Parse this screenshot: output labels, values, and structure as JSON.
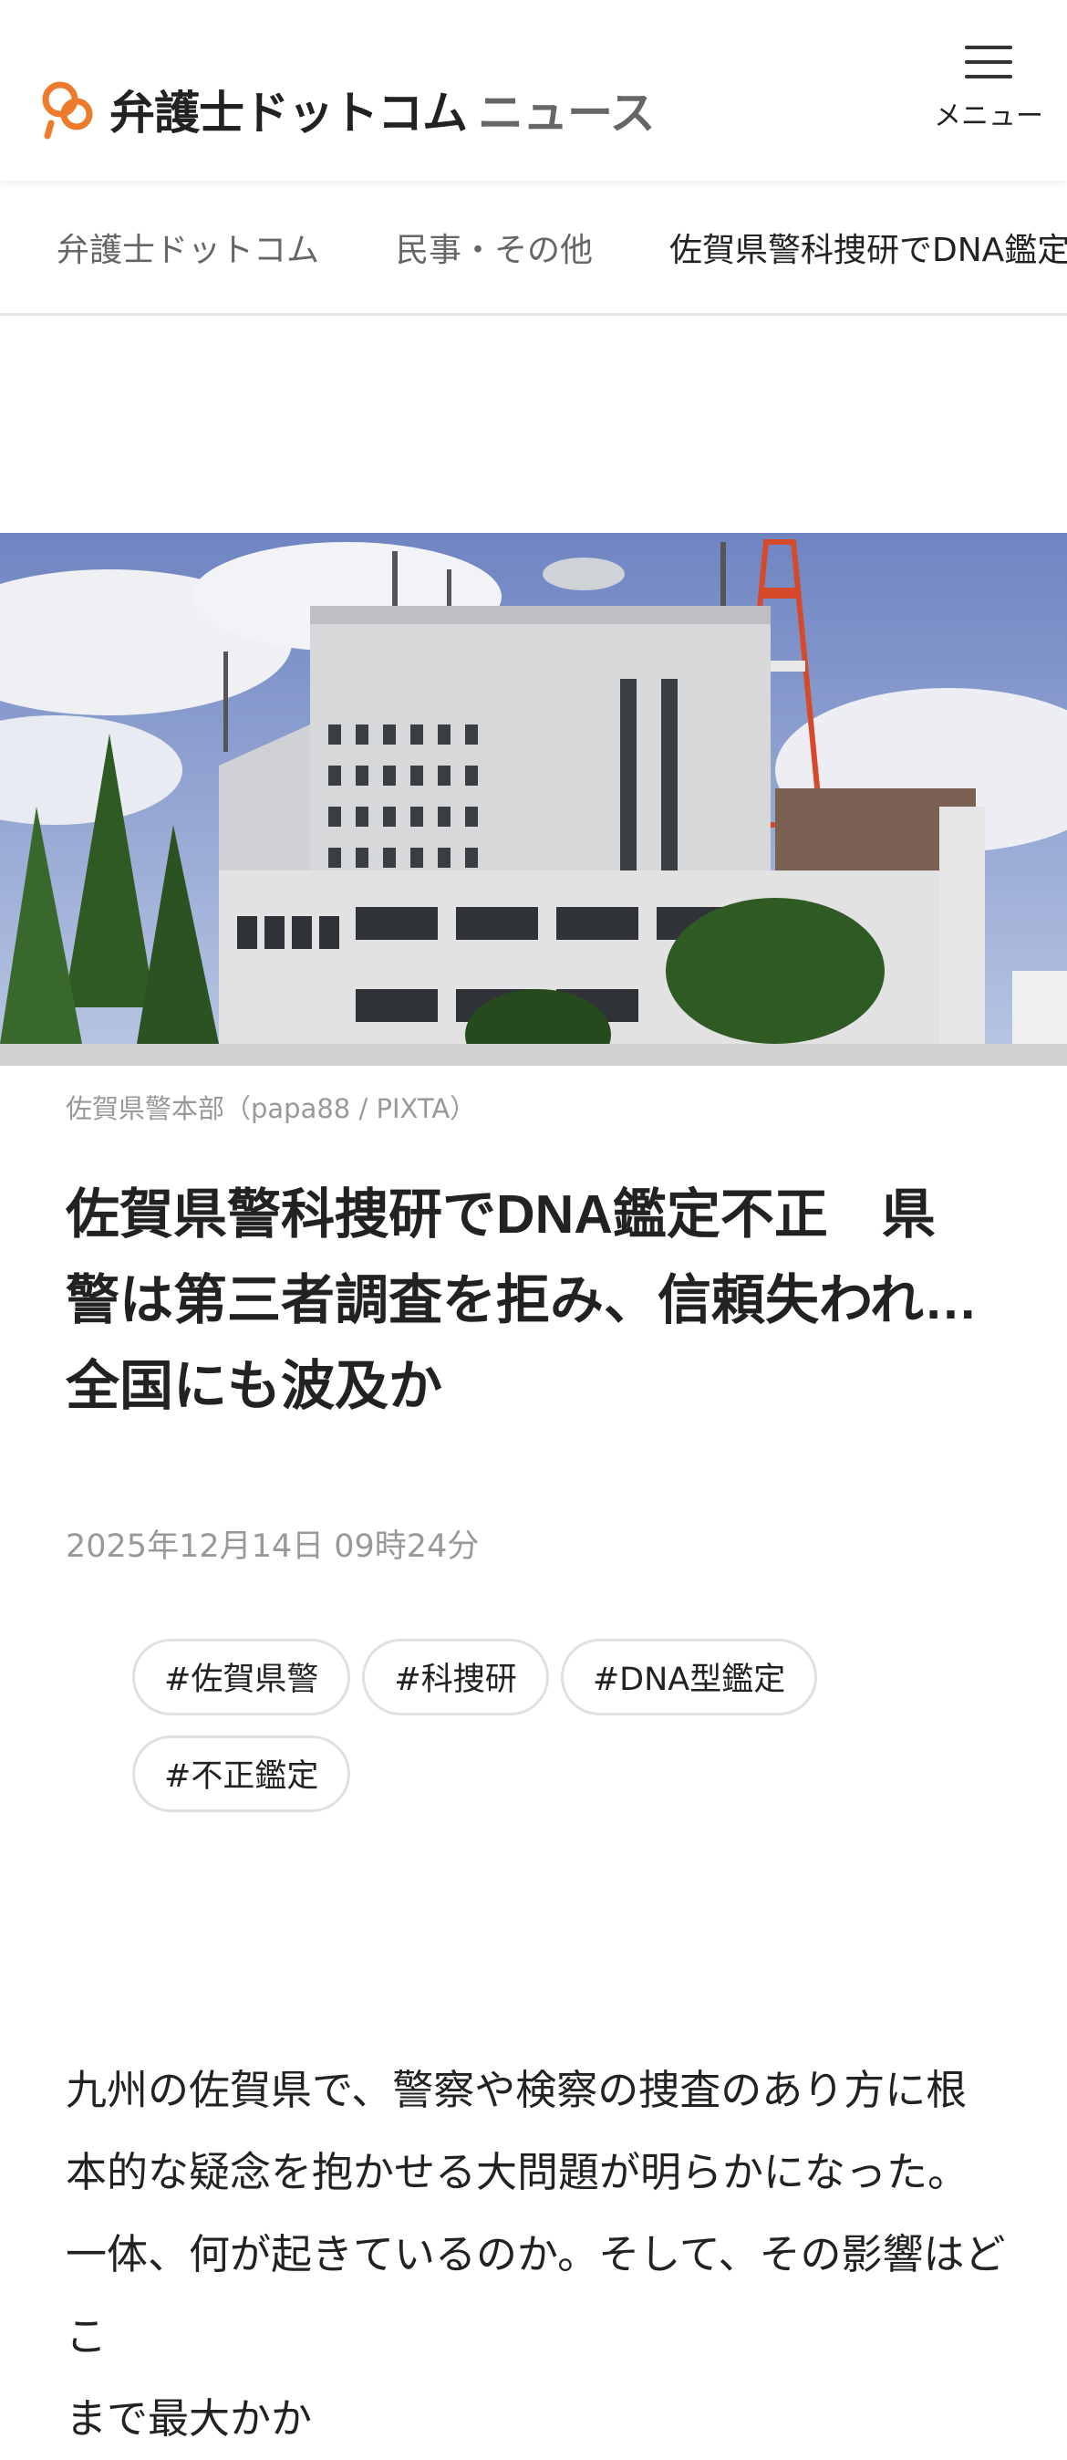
{
  "header": {
    "logo_main": "弁護士ドットコム",
    "logo_sub": "ニュース",
    "menu_label": "メニュー"
  },
  "breadcrumb": {
    "items": [
      "弁護士ドットコム",
      "民事・その他"
    ],
    "current": "佐賀県警科捜研でDNA鑑定不正　県警は第三者調査を拒み、信頼失われ…全国にも波及か"
  },
  "article": {
    "image_caption": "佐賀県警本部（papa88 / PIXTA）",
    "title_lines": [
      "佐賀県警科捜研でDNA鑑定不正　県",
      "警は第三者調査を拒み、信頼失われ…",
      "全国にも波及か"
    ],
    "date": "2025年12月14日 09時24分",
    "tags": [
      "#佐賀県警",
      "#科捜研",
      "#DNA型鑑定",
      "#不正鑑定"
    ],
    "body_lines": [
      "九州の佐賀県で、警察や検察の捜査のあり方に根",
      "本的な疑念を抱かせる大問題が明らかになった。",
      "一体、何が起きているのか。そして、その影響はどこ",
      "まで最大かか"
    ]
  },
  "colors": {
    "brand_orange": "#ee7a2c",
    "muted_text": "#999999"
  }
}
